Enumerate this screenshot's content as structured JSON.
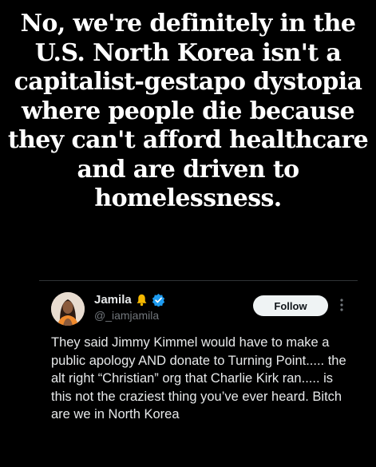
{
  "meme": {
    "caption": "No, we're definitely in the U.S. North Korea isn't a capitalist-gestapo dystopia where people die because they can't afford healthcare and are driven to homelessness."
  },
  "tweet": {
    "display_name": "Jamila",
    "handle": "@_iamjamila",
    "follow_label": "Follow",
    "text": "They said Jimmy Kimmel would have to make a public apology AND donate to Turning Point..... the alt right “Christian” org that Charlie Kirk ran..... is this not the craziest thing you’ve ever heard. Bitch are we in North Korea",
    "icons": {
      "bell": "bell-icon",
      "verified": "verified-badge-icon",
      "more": "more-options-icon"
    },
    "colors": {
      "verified": "#1d9bf0",
      "bell": "#f5b800",
      "follow_bg": "#eff3f4"
    }
  }
}
